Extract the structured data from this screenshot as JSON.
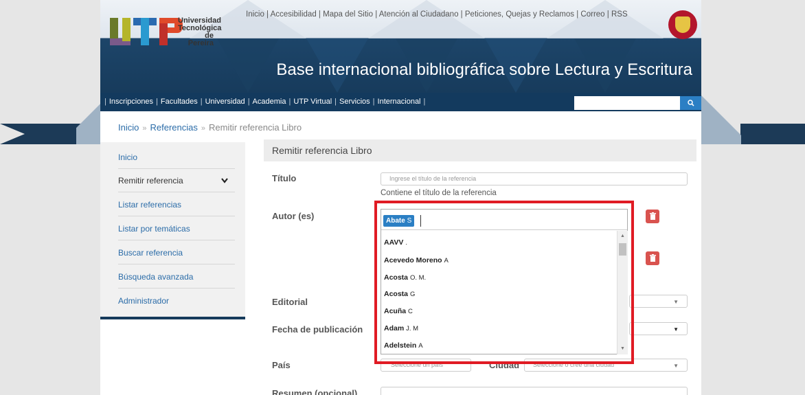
{
  "header": {
    "logo_line1": "Universidad",
    "logo_line2": "Tecnológica",
    "logo_line3": "de Pereira",
    "top_links": [
      "Inicio",
      "Accesibilidad",
      "Mapa del Sitio",
      "Atención al Ciudadano",
      "Peticiones, Quejas y Reclamos",
      "Correo",
      "RSS"
    ],
    "site_title": "Base internacional bibliográfica sobre Lectura y Escritura"
  },
  "navbar": {
    "items": [
      "Inscripciones",
      "Facultades",
      "Universidad",
      "Academia",
      "UTP Virtual",
      "Servicios",
      "Internacional"
    ],
    "search_placeholder": "",
    "search_icon": "search-icon"
  },
  "breadcrumb": {
    "items": [
      "Inicio",
      "Referencias"
    ],
    "current": "Remitir referencia Libro",
    "separator": "»"
  },
  "sidebar": {
    "items": [
      {
        "label": "Inicio"
      },
      {
        "label": "Remitir referencia"
      },
      {
        "label": "Listar referencias"
      },
      {
        "label": "Listar por temáticas"
      },
      {
        "label": "Buscar referencia"
      },
      {
        "label": "Búsqueda avanzada"
      },
      {
        "label": "Administrador"
      }
    ]
  },
  "form": {
    "heading": "Remitir referencia Libro",
    "titulo_label": "Título",
    "titulo_placeholder": "Ingrese el título de la referencia",
    "titulo_help": "Contiene el título de la referencia",
    "autor_label": "Autor (es)",
    "editorial_label": "Editorial",
    "fecha_label": "Fecha de publicación",
    "pais_label": "País",
    "pais_placeholder": "Seleccione un país",
    "ciudad_label": "Ciudad",
    "ciudad_placeholder": "Seleccione o cree una ciudad",
    "resumen_label": "Resumen (opcional)"
  },
  "autocomplete": {
    "selected_tag": {
      "surname": "Abate",
      "initials": "S"
    },
    "options": [
      {
        "surname": "AAVV",
        "initials": "."
      },
      {
        "surname": "Acevedo Moreno",
        "initials": "A"
      },
      {
        "surname": "Acosta",
        "initials": "O. M."
      },
      {
        "surname": "Acosta",
        "initials": "G"
      },
      {
        "surname": "Acuña",
        "initials": "C"
      },
      {
        "surname": "Adam",
        "initials": "J. M"
      },
      {
        "surname": "Adelstein",
        "initials": "A"
      }
    ]
  },
  "colors": {
    "brand_navy": "#173b5c",
    "accent_blue": "#2b7fc4",
    "delete_red": "#d9534f",
    "highlight_red": "#e01b24"
  }
}
